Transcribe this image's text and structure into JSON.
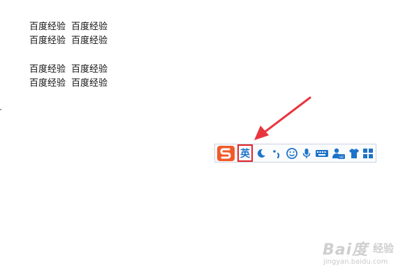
{
  "document": {
    "lines": [
      [
        "百度经验",
        "百度经验"
      ],
      [
        "百度经验",
        "百度经验"
      ],
      [
        "百度经验",
        "百度经验"
      ],
      [
        "百度经验",
        "百度经验"
      ]
    ]
  },
  "ime_toolbar": {
    "logo_icon": "sogou-s-logo-icon",
    "mode_label": "英",
    "icons": [
      "moon-icon",
      "punctuation-icon",
      "smiley-icon",
      "microphone-icon",
      "keyboard-icon",
      "user-icon",
      "shirt-icon",
      "grid-icon"
    ],
    "accent_color": "#1e73c8",
    "highlight_color": "#e2232a",
    "logo_color": "#f05a28"
  },
  "annotation": {
    "arrow_color": "#e8353d"
  },
  "watermark": {
    "brand": "Bai度",
    "suffix": "经验",
    "url": "jingyan.baidu.com"
  }
}
